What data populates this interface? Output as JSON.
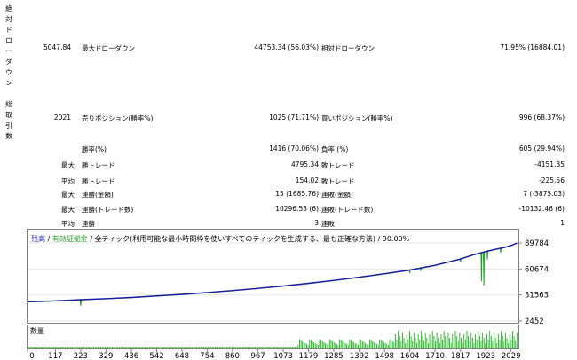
{
  "sections": {
    "absolute_drawdown_label": "絶対ドローダウン",
    "total_trades_label": "総取引数"
  },
  "drawdown_row": {
    "absolute_value": "5047.84",
    "max_label": "最大ドローダウン",
    "max_value": "44753.34 (56.03%)",
    "relative_label": "相対ドローダウン",
    "relative_value": "71.95% (16884.01)"
  },
  "trades_row": {
    "total_value": "2021",
    "sell_label": "売りポジション(勝率%)",
    "sell_value": "1025 (71.71%)",
    "buy_label": "買いポジション(勝率%)",
    "buy_value": "996 (68.37%)"
  },
  "stats_rows": [
    {
      "prefix": "",
      "label": "勝率(%)",
      "value": "1416 (70.06%)",
      "label2": "負率 (%)",
      "value2": "605 (29.94%)"
    },
    {
      "prefix": "最大",
      "label": "勝トレード",
      "value": "4795.34",
      "label2": "敗トレード",
      "value2": "-4151.35"
    },
    {
      "prefix": "平均",
      "label": "勝トレード",
      "value": "154.02",
      "label2": "敗トレード",
      "value2": "-225.56"
    },
    {
      "prefix": "最大",
      "label": "連勝(金額)",
      "value": "15 (1685.76)",
      "label2": "連敗(金額)",
      "value2": "7 (-3875.03)"
    },
    {
      "prefix": "最大",
      "label": "連勝(トレード数)",
      "value": "10296.53 (6)",
      "label2": "連敗(トレード数)",
      "value2": "-10132.46 (6)"
    },
    {
      "prefix": "平均",
      "label": "連勝",
      "value": "3",
      "label2": "連敗",
      "value2": "1"
    }
  ],
  "chart_data": {
    "type": "line",
    "legend": {
      "balance": "残高",
      "sep1": " / ",
      "equity": "有効証拠金",
      "rest": " / 全ティック(利用可能な最小時間枠を使いすべてのティックを生成する、最も正確な方法) / 90.00%"
    },
    "volume_label": "数量",
    "y_ticks": [
      89784,
      60674,
      31563,
      2452
    ],
    "x_ticks": [
      0,
      117,
      223,
      329,
      436,
      542,
      648,
      754,
      860,
      967,
      1073,
      1179,
      1285,
      1392,
      1498,
      1604,
      1710,
      1817,
      1923,
      2029
    ],
    "ylim": [
      2452,
      89784
    ],
    "xlim": [
      0,
      2060
    ],
    "balance_color": "#1a1aa8",
    "equity_color": "#22a022",
    "volume_color": "#22b522",
    "balance_series": {
      "name": "残高",
      "x": [
        0,
        117,
        223,
        329,
        436,
        542,
        648,
        754,
        860,
        967,
        1073,
        1179,
        1285,
        1392,
        1498,
        1604,
        1710,
        1817,
        1870,
        1923,
        1960,
        2000,
        2029,
        2055
      ],
      "y": [
        24000,
        25000,
        26300,
        27500,
        28800,
        30500,
        32200,
        34300,
        36500,
        39000,
        41700,
        44600,
        47900,
        51500,
        55300,
        59500,
        64800,
        71800,
        76500,
        80200,
        82500,
        84700,
        87000,
        89784
      ]
    },
    "equity_dips": [
      {
        "x": 223,
        "y": 19500
      },
      {
        "x": 1604,
        "y": 56000
      },
      {
        "x": 1650,
        "y": 58500
      },
      {
        "x": 1817,
        "y": 68500
      },
      {
        "x": 1905,
        "y": 47000
      },
      {
        "x": 1915,
        "y": 42000
      },
      {
        "x": 1930,
        "y": 71000
      },
      {
        "x": 1985,
        "y": 79000
      }
    ]
  }
}
